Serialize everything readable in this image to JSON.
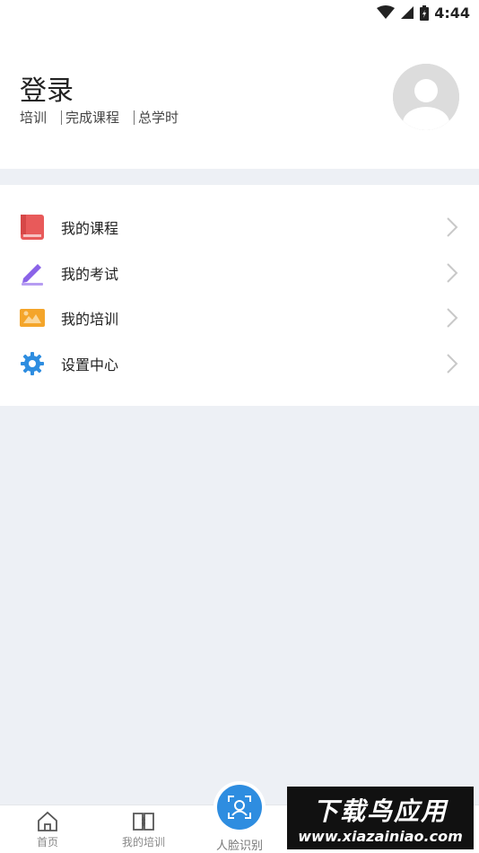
{
  "status_bar": {
    "time": "4:44"
  },
  "profile": {
    "title": "登录",
    "stats": [
      "培训",
      "完成课程",
      "总学时"
    ]
  },
  "menu": [
    {
      "label": "我的课程",
      "icon": "book-icon",
      "color": "#e85a5a"
    },
    {
      "label": "我的考试",
      "icon": "pen-icon",
      "color": "#8a63e8"
    },
    {
      "label": "我的培训",
      "icon": "training-icon",
      "color": "#f4a52a"
    },
    {
      "label": "设置中心",
      "icon": "gear-icon",
      "color": "#2e8de0"
    }
  ],
  "tabbar": {
    "home": "首页",
    "my_training": "我的培训",
    "face_recognition": "人脸识别"
  },
  "watermark": {
    "line1": "下载鸟应用",
    "line2": "www.xiazainiao.com"
  },
  "colors": {
    "accent": "#2e8de0",
    "background": "#edf0f5"
  }
}
